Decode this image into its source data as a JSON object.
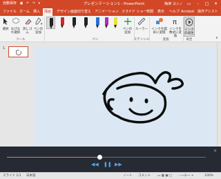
{
  "titlebar": {
    "autosave": "自動保存",
    "filename": "プレゼンテーション1 - PowerPoint",
    "user": "梅津 ヨンノ",
    "colors": {
      "accent": "#d24726"
    }
  },
  "tabs": [
    "ファイル",
    "ホーム",
    "挿入",
    "描画",
    "デザイン",
    "画面切り替え",
    "アニメーション",
    "スライド ショー",
    "校閲",
    "表示",
    "ヘルプ",
    "Acrobat",
    "操作アシスト"
  ],
  "active_tab": "描画",
  "ribbon": {
    "tools": {
      "select": "選択",
      "lasso": "なげなわ選択",
      "eraser": "消しゴム",
      "add_pen": "ペンの追加",
      "group_label": "ツール"
    },
    "pens_label": "ペン",
    "pen_colors": [
      "#222222",
      "#cc2a1e",
      "#222222",
      "#222222",
      "#2a6fd6",
      "#b12ab1",
      "#e8e23a"
    ],
    "add_pen": "ペンの追加",
    "ruler": "ルーラー",
    "stencil_label": "ステンシル",
    "ink_to_shape": "インクを図形に変換",
    "ink_to_math": "インクを数式に変換",
    "convert_label": "変換",
    "ink_replay": "インクの再生",
    "replay_label": "再生"
  },
  "thumbpane": {
    "slide_number": "1"
  },
  "status": {
    "slide": "スライド 1/1",
    "lang": "日本語",
    "notes": "ノート",
    "comments": "コメント",
    "zoom": "100%"
  }
}
